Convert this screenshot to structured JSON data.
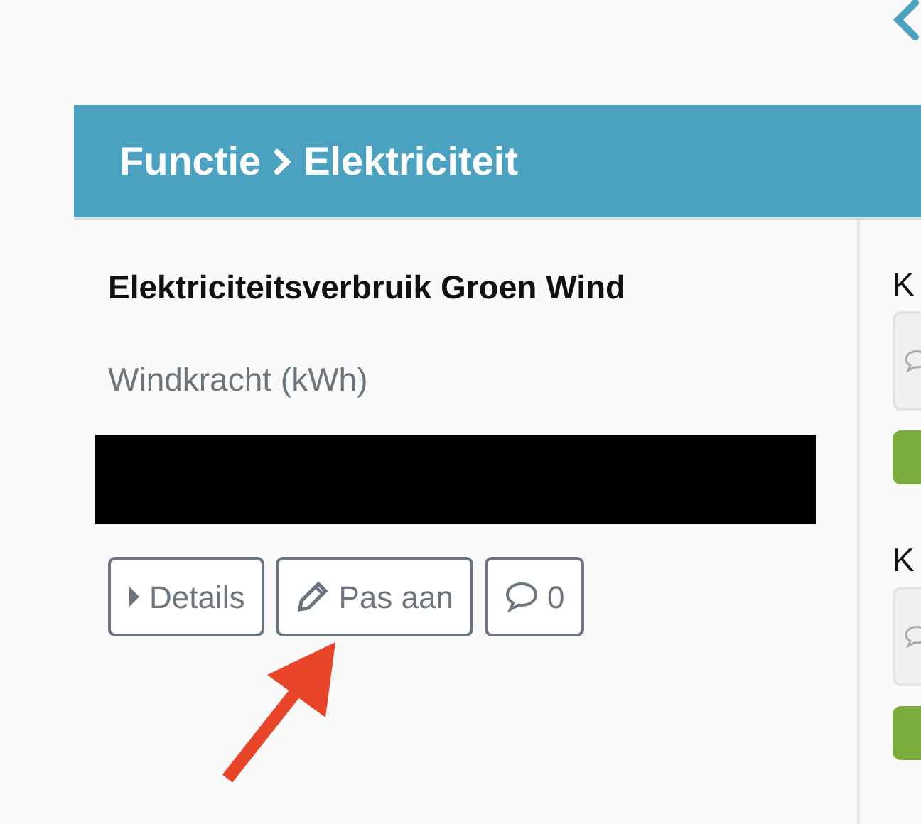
{
  "header": {
    "parts": [
      "Functie",
      "Elektriciteit"
    ]
  },
  "item": {
    "title": "Elektriciteitsverbruik Groen Wind",
    "subtitle": "Windkracht (kWh)",
    "buttons": [
      {
        "kind": "details",
        "label": "Details"
      },
      {
        "kind": "edit",
        "label": "Pas aan"
      },
      {
        "kind": "comments",
        "label": "0"
      }
    ]
  },
  "side_items": [
    {
      "title": "K"
    },
    {
      "title": "K"
    }
  ]
}
